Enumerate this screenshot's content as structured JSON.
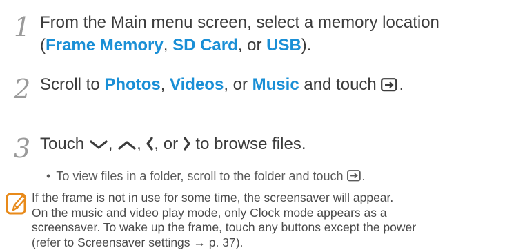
{
  "steps": [
    {
      "num": "1",
      "line1": "From the Main menu screen, select a memory location",
      "line2_open": "(",
      "loc1": "Frame Memory",
      "sep1": ", ",
      "loc2": "SD Card",
      "sep2": ", or ",
      "loc3": "USB",
      "line2_close": ")."
    },
    {
      "num": "2",
      "pre": "Scroll to ",
      "item1": "Photos",
      "sep1": ", ",
      "item2": "Videos",
      "sep2": ", or ",
      "item3": "Music",
      "mid": " and touch ",
      "end": ".",
      "icon": "enter-icon"
    },
    {
      "num": "3",
      "pre": "Touch ",
      "sep1": ", ",
      "sep2": ", ",
      "sep3": ", or ",
      "post": " to browse files.",
      "icons": [
        "chevron-down-icon",
        "chevron-up-icon",
        "chevron-left-icon",
        "chevron-right-icon"
      ]
    }
  ],
  "bullet": {
    "dot": "•",
    "text": "To view files in a folder, scroll to the folder and touch ",
    "end": ".",
    "icon": "enter-icon"
  },
  "note": {
    "icon": "note-pencil-icon",
    "lines": [
      "If the frame is not in use for some time, the screensaver will appear.",
      "On the music and video play mode, only Clock mode appears as a",
      "screensaver. To wake up the frame, touch any buttons except the power",
      "(refer to Screensaver settings → p. 37)."
    ]
  },
  "colors": {
    "highlight": "#1a8fd6",
    "note_icon": "#e88a1a",
    "text": "#3c3c3c"
  }
}
